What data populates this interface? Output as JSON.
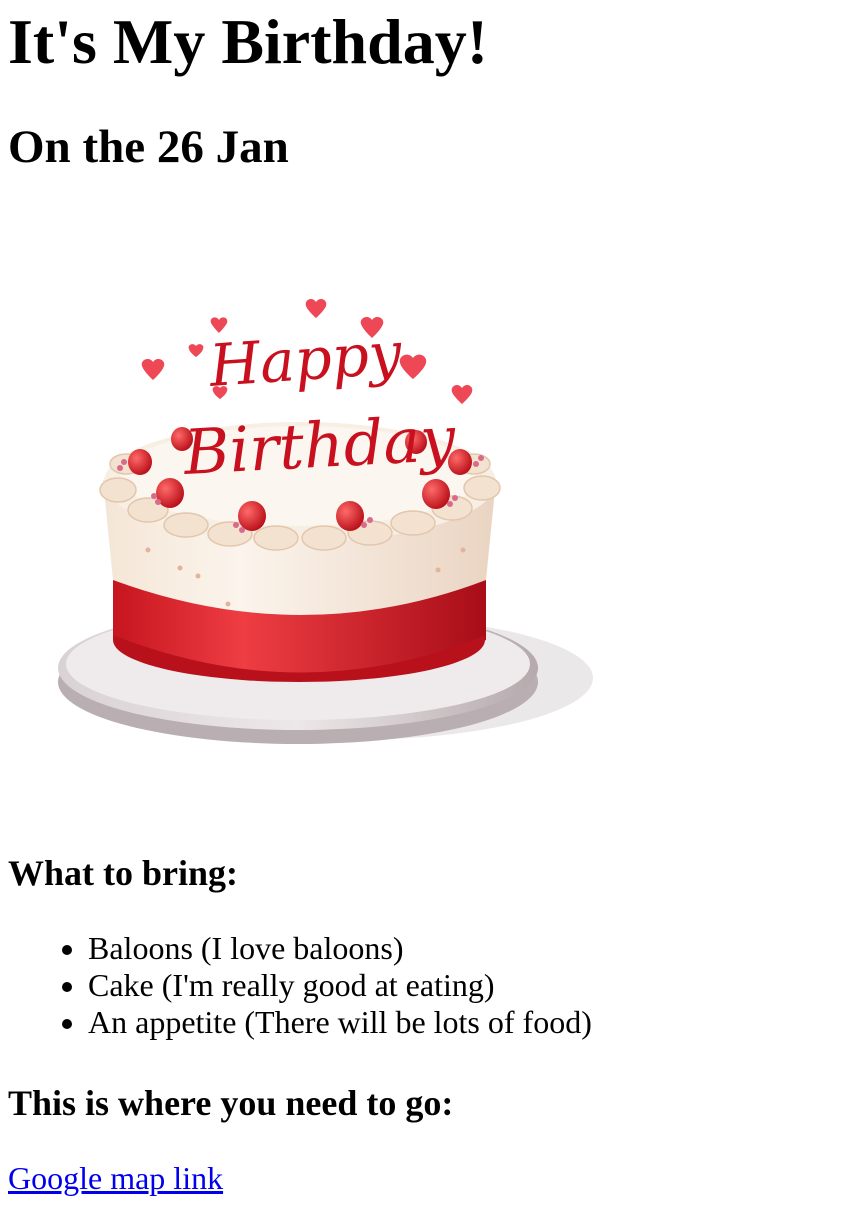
{
  "header": {
    "title": "It's My Birthday!",
    "date": "On the 26 Jan"
  },
  "cake_image": {
    "icon": "birthday-cake-image",
    "lettering": [
      "Happy",
      "Birthday"
    ],
    "colors": {
      "frosting": "#f6ece0",
      "ribbon": "#d21c2a",
      "plate": "#e9e4e6",
      "hearts": "#ee4857",
      "script": "#c8101e"
    }
  },
  "bring": {
    "heading": "What to bring:",
    "items": [
      "Baloons (I love baloons)",
      "Cake (I'm really good at eating)",
      "An appetite (There will be lots of food)"
    ]
  },
  "location": {
    "heading": "This is where you need to go:",
    "link_text": "Google map link"
  }
}
